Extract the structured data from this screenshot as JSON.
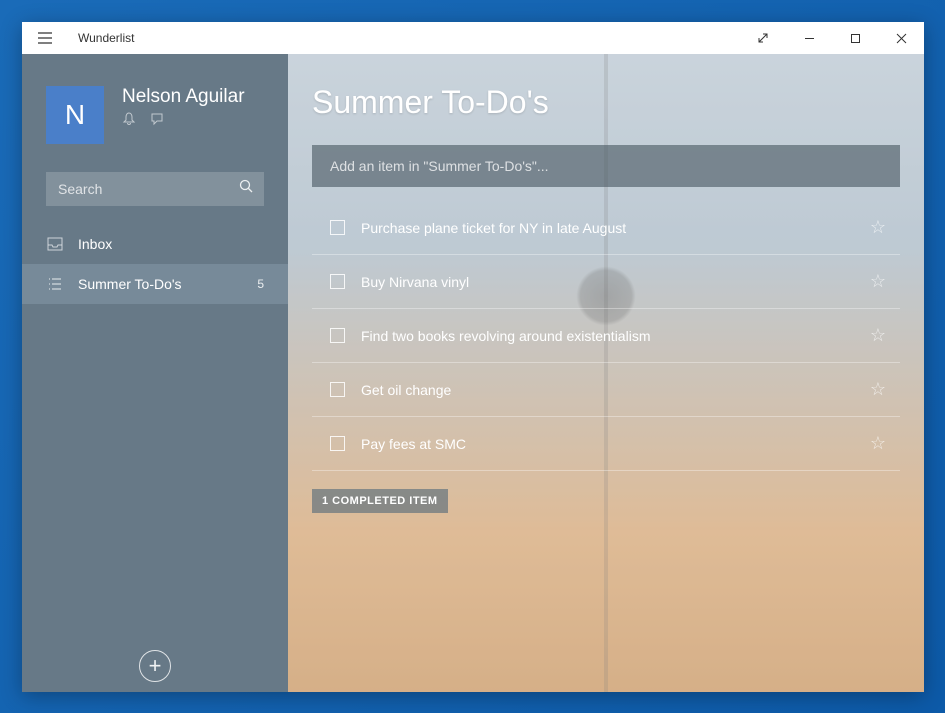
{
  "window": {
    "app_title": "Wunderlist"
  },
  "profile": {
    "avatar_initial": "N",
    "user_name": "Nelson Aguilar"
  },
  "search": {
    "placeholder": "Search"
  },
  "sidebar_lists": [
    {
      "icon": "inbox",
      "label": "Inbox",
      "count": "",
      "active": false
    },
    {
      "icon": "list",
      "label": "Summer To-Do's",
      "count": "5",
      "active": true
    }
  ],
  "main": {
    "list_title": "Summer To-Do's",
    "add_placeholder": "Add an item in \"Summer To-Do's\"...",
    "tasks": [
      {
        "label": "Purchase plane ticket for NY in late August"
      },
      {
        "label": "Buy Nirvana vinyl"
      },
      {
        "label": "Find two books revolving around existentialism"
      },
      {
        "label": "Get oil change"
      },
      {
        "label": "Pay fees at SMC"
      }
    ],
    "completed_label": "1 COMPLETED ITEM"
  }
}
